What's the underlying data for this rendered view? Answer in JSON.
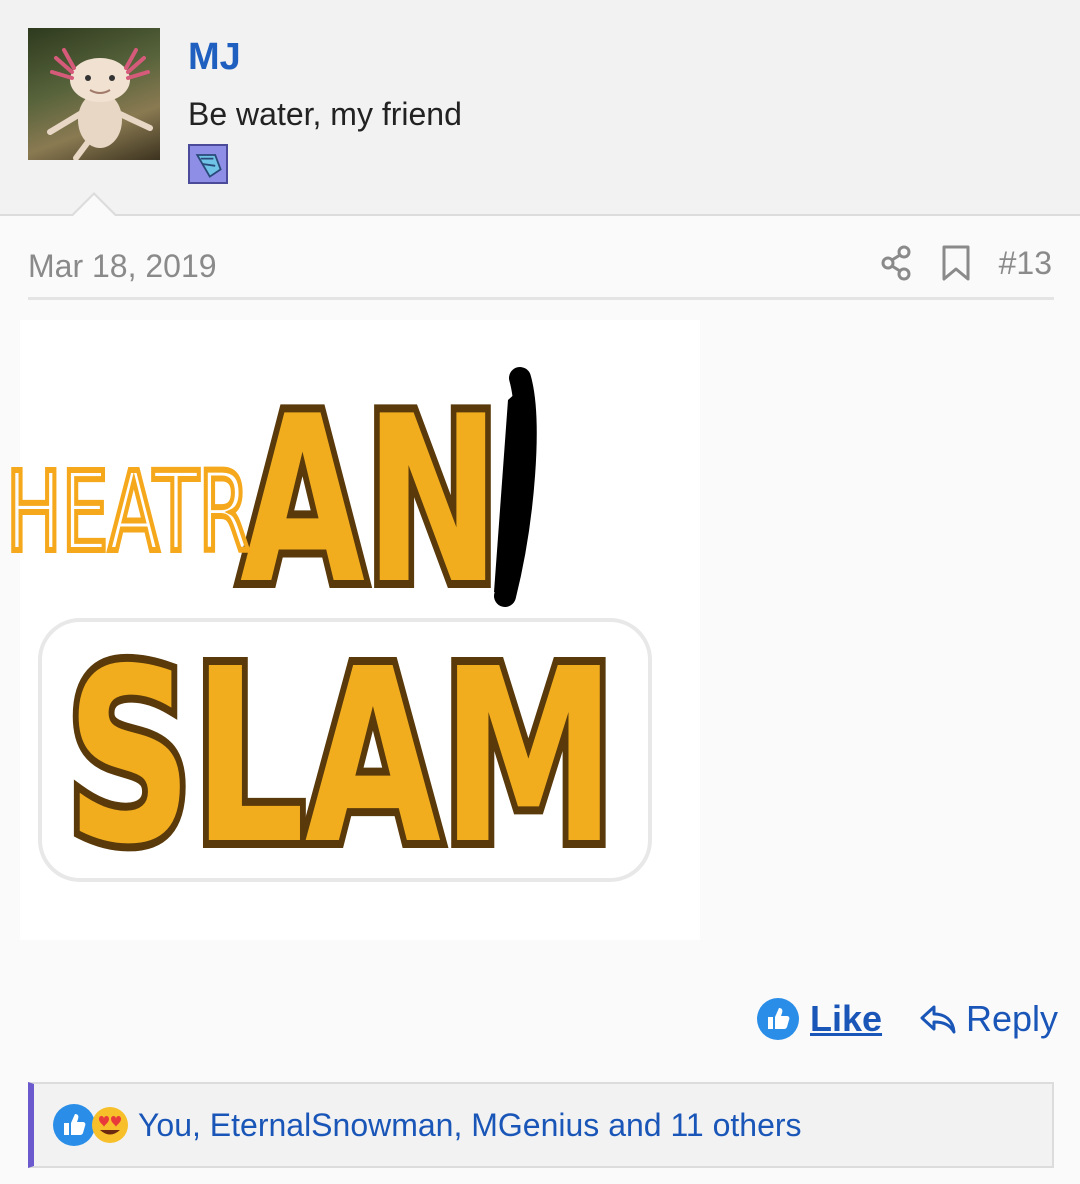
{
  "author": {
    "username": "MJ",
    "tagline": "Be water, my friend",
    "avatar_icon": "axolotl-avatar",
    "badge_icon": "trophy-badge-icon"
  },
  "post": {
    "date": "Mar 18, 2019",
    "number": "#13",
    "share_icon": "share-icon",
    "bookmark_icon": "bookmark-icon"
  },
  "image": {
    "handwritten_text": "HEATR",
    "top_word": "AN",
    "bottom_word": "SLAM",
    "colors": {
      "fill": "#f2ad1f",
      "outline": "#5a3a0a",
      "handwriting": "#f5a81c",
      "scribble": "#000000"
    }
  },
  "actions": {
    "like_label": "Like",
    "reply_label": "Reply"
  },
  "reactions": {
    "text": "You, EternalSnowman, MGenius and 11 others"
  },
  "colors": {
    "link": "#1a56b8",
    "username": "#1f5fbf",
    "muted": "#8a8a8a",
    "reaction_border": "#6a5acd"
  }
}
